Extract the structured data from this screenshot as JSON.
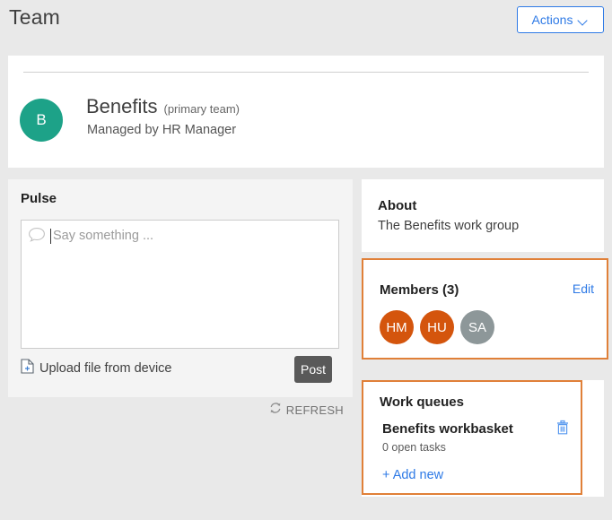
{
  "header": {
    "title": "Team",
    "actions_label": "Actions",
    "chevron_icon": "chevron-down-icon"
  },
  "team": {
    "avatar_initial": "B",
    "avatar_color": "#1da288",
    "name": "Benefits",
    "primary_label": "(primary team)",
    "managed_by": "Managed by HR Manager"
  },
  "pulse": {
    "heading": "Pulse",
    "composer_placeholder": "Say something ...",
    "composer_value": "",
    "bubble_icon": "speech-bubble-icon",
    "upload_icon": "file-add-icon",
    "upload_label": "Upload file from device",
    "post_label": "Post",
    "refresh_icon": "refresh-icon",
    "refresh_label": "REFRESH"
  },
  "about": {
    "heading": "About",
    "description": "The Benefits work group"
  },
  "members": {
    "heading": "Members (3)",
    "edit_label": "Edit",
    "highlight_color": "#e08038",
    "avatars": [
      {
        "initials": "HM",
        "color": "#d4550d"
      },
      {
        "initials": "HU",
        "color": "#d4550d"
      },
      {
        "initials": "SA",
        "color": "#8d9799"
      }
    ]
  },
  "work_queues": {
    "heading": "Work queues",
    "highlight_color": "#e08038",
    "item_name": "Benefits workbasket",
    "item_subtext": "0 open tasks",
    "delete_icon": "trash-icon",
    "add_new_label": "+ Add new"
  }
}
